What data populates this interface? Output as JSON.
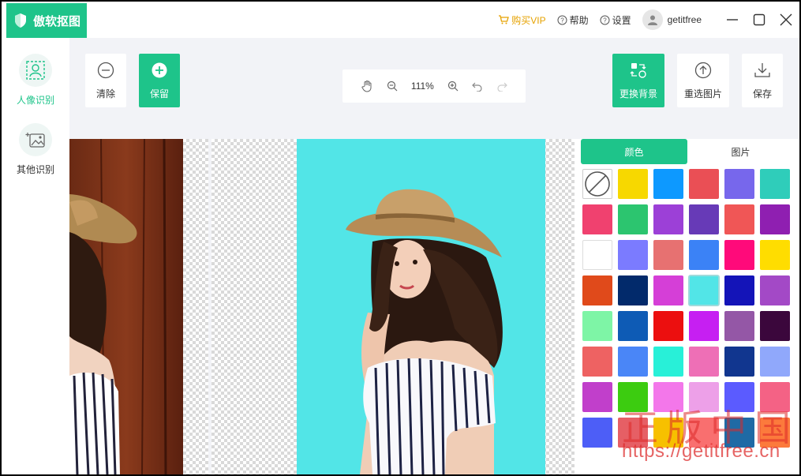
{
  "app": {
    "title": "傲软抠图"
  },
  "titlebar": {
    "vip": "购买VIP",
    "help": "帮助",
    "settings": "设置",
    "username": "getitfree"
  },
  "sidebar": {
    "items": [
      {
        "label": "人像识别"
      },
      {
        "label": "其他识别"
      }
    ]
  },
  "toolbar": {
    "clear": "清除",
    "keep": "保留",
    "zoom": "111%",
    "change_bg": "更换背景",
    "reselect": "重选图片",
    "save": "保存"
  },
  "panel": {
    "tabs": [
      {
        "label": "颜色"
      },
      {
        "label": "图片"
      }
    ],
    "swatches": [
      "none",
      "#f7d800",
      "#0d99ff",
      "#ea4f55",
      "#7767ec",
      "#2fcdba",
      "#f0416f",
      "#2cc56f",
      "#9c40d7",
      "#673ab7",
      "#f05656",
      "#8f1fb1",
      "#ffffff",
      "#7b7bff",
      "#e77171",
      "#3b82f6",
      "#ff0a7a",
      "#ffdd00",
      "#e04a1b",
      "#022a6b",
      "#d53fd7",
      "#52e5e7",
      "#1414b8",
      "#a349c6",
      "#7ef5a6",
      "#0e5bb5",
      "#ec0f0f",
      "#c61ff2",
      "#9457a6",
      "#3b073c",
      "#ee6262",
      "#4a86f7",
      "#28f0d8",
      "#ee6fb6",
      "#11368f",
      "#90a8fb",
      "#c13fcb",
      "#3ccc10",
      "#f377ea",
      "#eda0e8",
      "#5b5bff",
      "#f46285",
      "#4d5ef7",
      "#e65f65",
      "#f7c000",
      "#f96f6f",
      "#1f6aa5",
      "#fc7a3c"
    ],
    "selected": "#52e5e7"
  },
  "watermark": {
    "cn": "正版中国",
    "url": "https://getitfree.cn"
  },
  "colors": {
    "accent": "#1ec48a",
    "vip": "#e6a200"
  }
}
